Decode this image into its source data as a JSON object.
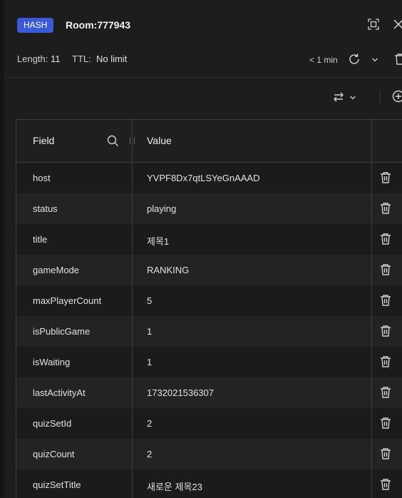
{
  "header": {
    "type_badge": "HASH",
    "key_name": "Room:777943",
    "length_label": "Length:",
    "length_value": "11",
    "ttl_label": "TTL:",
    "ttl_value": "No limit",
    "last_refresh": "< 1 min"
  },
  "table": {
    "columns": {
      "field": "Field",
      "value": "Value"
    },
    "rows": [
      {
        "field": "host",
        "value": "YVPF8Dx7qtLSYeGnAAAD"
      },
      {
        "field": "status",
        "value": "playing"
      },
      {
        "field": "title",
        "value": "제목1"
      },
      {
        "field": "gameMode",
        "value": "RANKING"
      },
      {
        "field": "maxPlayerCount",
        "value": "5"
      },
      {
        "field": "isPublicGame",
        "value": "1"
      },
      {
        "field": "isWaiting",
        "value": "1"
      },
      {
        "field": "lastActivityAt",
        "value": "1732021536307"
      },
      {
        "field": "quizSetId",
        "value": "2"
      },
      {
        "field": "quizCount",
        "value": "2"
      },
      {
        "field": "quizSetTitle",
        "value": "새로운 제목23"
      }
    ]
  },
  "icons": {
    "expand": "fullscreen-icon",
    "close": "close-icon",
    "refresh": "refresh-icon",
    "dropdown": "chevron-down-icon",
    "delete": "trash-icon",
    "format": "swap-arrows-icon",
    "add": "add-circle-icon",
    "search": "search-icon"
  },
  "colors": {
    "badge": "#3b5ad6",
    "background": "#1d1d1d"
  }
}
